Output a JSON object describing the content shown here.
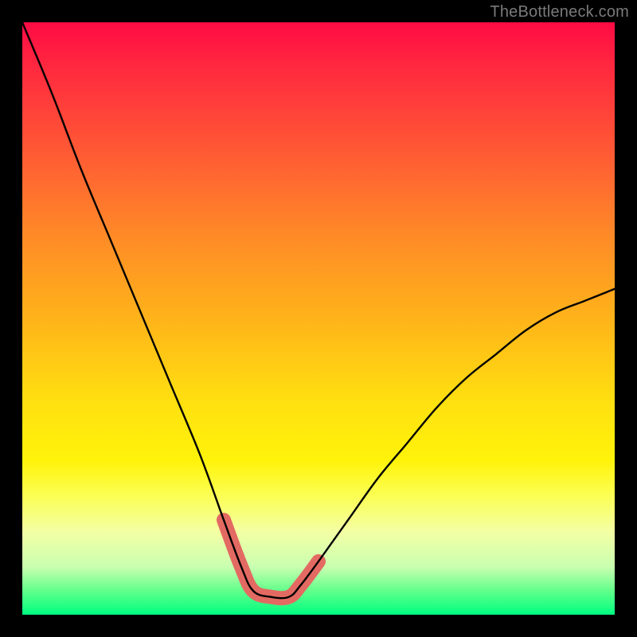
{
  "watermark": "TheBottleneck.com",
  "chart_data": {
    "type": "line",
    "title": "",
    "xlabel": "",
    "ylabel": "",
    "xlim": [
      0,
      100
    ],
    "ylim": [
      0,
      100
    ],
    "grid": false,
    "legend": false,
    "comment": "Bottleneck curve: V-shape. y≈100 at x=0, dips to ~3 around x=38–46, rises to ~55 at x=100. Valley floor highlighted in salmon.",
    "series": [
      {
        "name": "bottleneck-curve",
        "color": "#000000",
        "x": [
          0,
          5,
          10,
          15,
          20,
          25,
          30,
          34,
          37,
          39,
          42,
          45,
          47,
          50,
          55,
          60,
          65,
          70,
          75,
          80,
          85,
          90,
          95,
          100
        ],
        "values": [
          100,
          88,
          75,
          63,
          51,
          39,
          27,
          16,
          8,
          4,
          3,
          3,
          5,
          9,
          16,
          23,
          29,
          35,
          40,
          44,
          48,
          51,
          53,
          55
        ]
      },
      {
        "name": "valley-highlight",
        "color": "#e36a62",
        "x": [
          34,
          37,
          39,
          42,
          45,
          47,
          50
        ],
        "values": [
          16,
          8,
          4,
          3,
          3,
          5,
          9
        ]
      }
    ]
  }
}
